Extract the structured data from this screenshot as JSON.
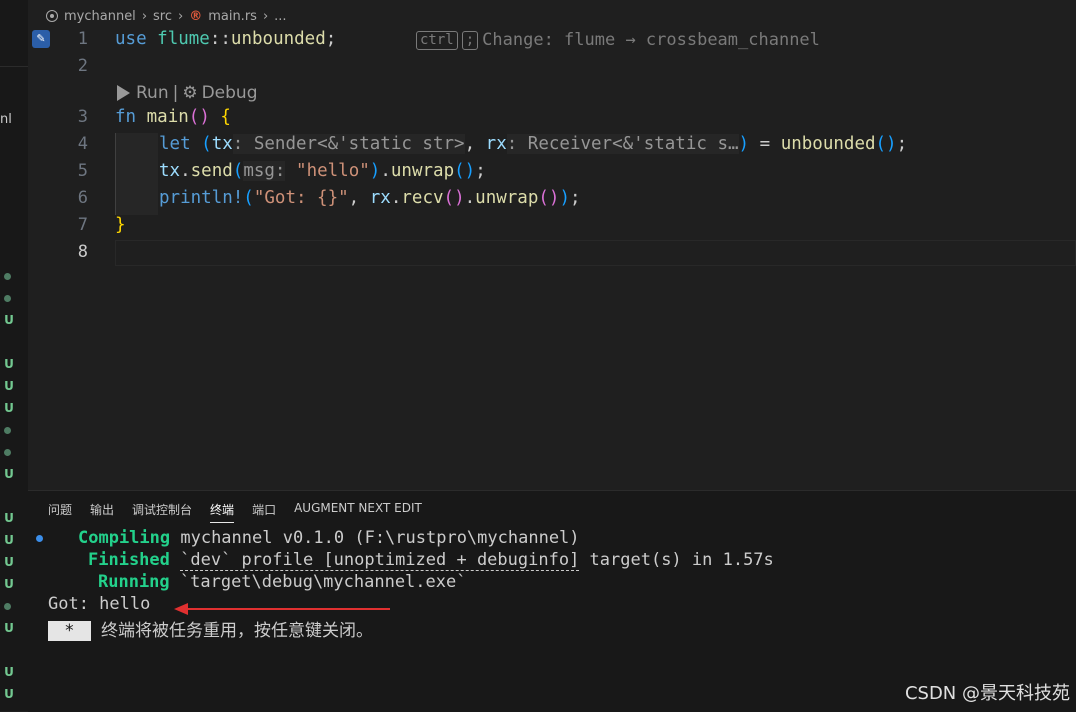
{
  "breadcrumb": {
    "project": "mychannel",
    "folder": "src",
    "file": "main.rs",
    "more": "..."
  },
  "sidebar": {
    "partial_text": "nl",
    "git_status": [
      "•",
      "•",
      "U",
      "U",
      "U",
      "U",
      "•",
      "•",
      "U",
      "U",
      "U",
      "U",
      "U",
      "•",
      "U",
      "U",
      "U"
    ]
  },
  "editor": {
    "line_numbers": [
      "1",
      "2",
      "3",
      "4",
      "5",
      "6",
      "7",
      "8"
    ],
    "line1": {
      "use": "use",
      "flume": "flume",
      "sep": "::",
      "unbounded": "unbounded",
      "semi": ";"
    },
    "ghost_hint": {
      "key1": "ctrl",
      "key2": ";",
      "text": "Change: flume → crossbeam_channel"
    },
    "codelens": {
      "run": "Run",
      "divider": "|",
      "debug": "Debug",
      "debug_icon": "gear-icon"
    },
    "line3": {
      "fn": "fn",
      "name": "main",
      "parens": "()",
      "brace": "{"
    },
    "line4": {
      "let": "let",
      "open": "(",
      "tx": "tx",
      "tx_hint": ": Sender<&'static str>",
      "comma": ", ",
      "rx": "rx",
      "rx_hint": ": Receiver<&'static s…",
      "close": ")",
      "eq": " = ",
      "call": "unbounded",
      "call_parens": "()",
      "semi": ";"
    },
    "line5": {
      "tx": "tx",
      "dot": ".",
      "send": "send",
      "open": "(",
      "hint": "msg:",
      "str": "\"hello\"",
      "close": ")",
      "dot2": ".",
      "unwrap": "unwrap",
      "parens": "()",
      "semi": ";"
    },
    "line6": {
      "macro": "println!",
      "open": "(",
      "str": "\"Got: {}\"",
      "comma": ", ",
      "rx": "rx",
      "dot": ".",
      "recv": "recv",
      "parens1": "()",
      "dot2": ".",
      "unwrap": "unwrap",
      "parens2": "()",
      "close": ")",
      "semi": ";"
    },
    "line7": {
      "brace": "}"
    }
  },
  "panel": {
    "tabs": [
      "问题",
      "输出",
      "调试控制台",
      "终端",
      "端口",
      "AUGMENT NEXT EDIT"
    ],
    "active_tab": "终端",
    "terminal": {
      "compiling_label": "Compiling",
      "compiling_text": " mychannel v0.1.0 (F:\\rustpro\\mychannel)",
      "finished_label": "Finished",
      "finished_profile": "`dev` profile [unoptimized + debuginfo]",
      "finished_text": " target(s) in 1.57s",
      "running_label": "Running",
      "running_text": " `target\\debug\\mychannel.exe`",
      "output": "Got: hello",
      "prompt_symbol": " * ",
      "prompt_text": " 终端将被任务重用，按任意键关闭。"
    }
  },
  "annotation": {
    "arrow_color": "#e03030"
  },
  "watermark": "CSDN @景天科技苑",
  "colors": {
    "keyword": "#569cd6",
    "identifier": "#9cdcfe",
    "function": "#dcdcaa",
    "string": "#ce9178",
    "brace": "#ffd700",
    "terminal_green": "#23d18b"
  }
}
